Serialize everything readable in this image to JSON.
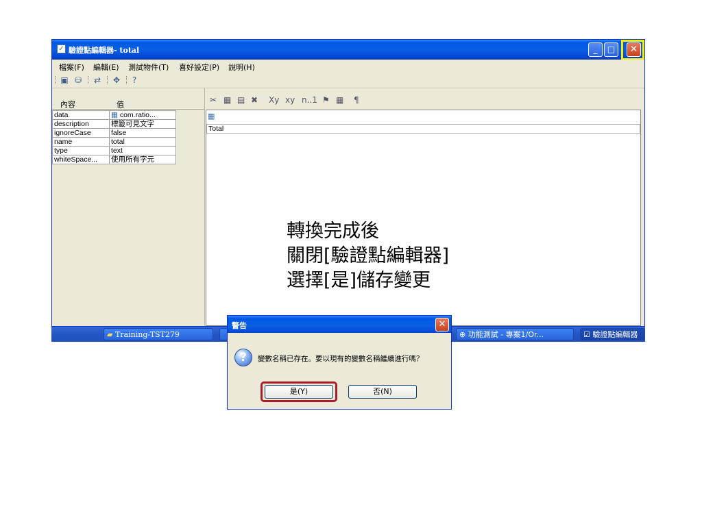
{
  "window": {
    "title": "驗證點編輯器- total",
    "menu": [
      "檔案(F)",
      "編輯(E)",
      "測試物件(T)",
      "喜好設定(P)",
      "說明(H)"
    ],
    "toolbar_icons": [
      "save-icon",
      "save-as-icon",
      "convert-icon",
      "settings-icon",
      "help-icon"
    ]
  },
  "properties": {
    "header_key": "內容",
    "header_value": "值",
    "rows": [
      {
        "key": "data",
        "value": "com.ratio..."
      },
      {
        "key": "description",
        "value": "標籤可見文字"
      },
      {
        "key": "ignoreCase",
        "value": "false"
      },
      {
        "key": "name",
        "value": "total"
      },
      {
        "key": "type",
        "value": "text"
      },
      {
        "key": "whiteSpace...",
        "value": "使用所有字元"
      }
    ]
  },
  "editor": {
    "toolbar": [
      "✂",
      "▦",
      "▤",
      "✖",
      "Xy",
      "xy",
      "n..1",
      "⚑",
      "▦",
      "¶"
    ],
    "content": "Total"
  },
  "note": {
    "line1": "轉換完成後",
    "line2": "關閉[驗證點編輯器]",
    "line3": "選擇[是]儲存變更"
  },
  "taskbar": {
    "items": [
      "Training-TST279",
      "功能測試 - 專案1/Or...",
      "驗證點編輯器"
    ]
  },
  "dialog": {
    "title": "警告",
    "message": "變數名稱已存在。要以現有的變數名稱繼續進行嗎？",
    "yes_label": "是(Y)",
    "no_label": "否(N)"
  },
  "colors": {
    "titlebar": "#0058e6",
    "highlight_close": "#f5f000",
    "highlight_yes": "#a81e2a"
  }
}
